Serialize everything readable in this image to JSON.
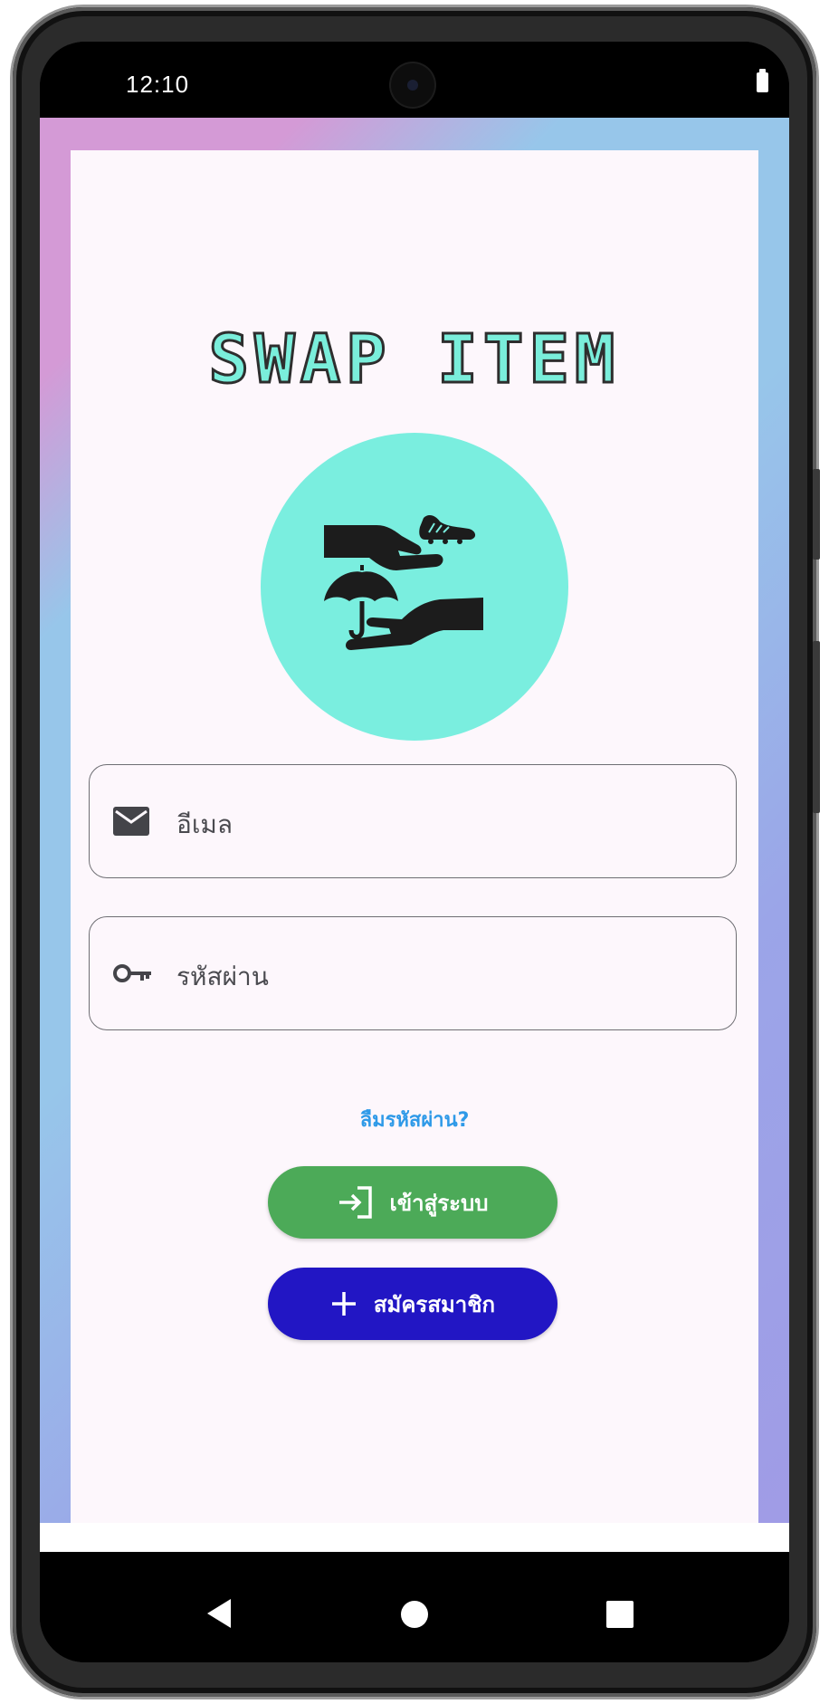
{
  "status_bar": {
    "time": "12:10"
  },
  "app": {
    "title": "SWAP ITEM",
    "logo_icon": "hands-swap-icon",
    "email_field": {
      "placeholder": "อีเมล",
      "icon": "mail-icon"
    },
    "password_field": {
      "placeholder": "รหัสผ่าน",
      "icon": "key-icon"
    },
    "forgot_password_label": "ลืมรหัสผ่าน?",
    "login_button": {
      "label": "เข้าสู่ระบบ",
      "icon": "login-icon",
      "color": "#4caa58"
    },
    "signup_button": {
      "label": "สมัครสมาชิก",
      "icon": "plus-icon",
      "color": "#2216c4"
    },
    "title_color": "#7aeedb",
    "logo_bg_color": "#7aeedf",
    "link_color": "#2f9ae8"
  },
  "nav_bar": {
    "back_icon": "back-icon",
    "home_icon": "home-icon",
    "recents_icon": "recents-icon"
  }
}
